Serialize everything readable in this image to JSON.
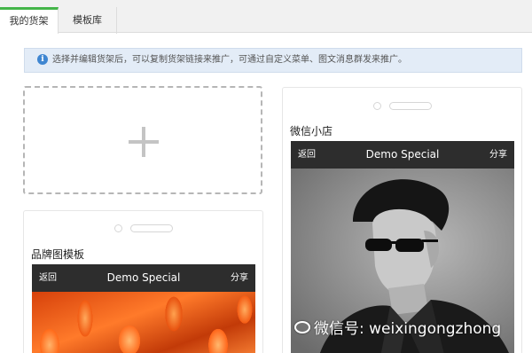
{
  "tabs": [
    {
      "label": "我的货架",
      "active": true
    },
    {
      "label": "模板库",
      "active": false
    }
  ],
  "notice": {
    "icon": "info-icon",
    "text": "选择并编辑货架后，可以复制货架链接来推广，可通过自定义菜单、图文消息群发来推广。"
  },
  "add_shelf": {
    "icon": "plus-icon"
  },
  "templates": [
    {
      "title": "品牌图模板",
      "phone": {
        "back": "返回",
        "title": "Demo Special",
        "share": "分享"
      },
      "image": "orange-flower-petals"
    },
    {
      "title": "微信小店",
      "phone": {
        "back": "返回",
        "title": "Demo Special",
        "share": "分享"
      },
      "image": "man-in-sunglasses-bw"
    }
  ],
  "watermark": {
    "text": "微信号: weixingongzhong",
    "icon": "wechat-icon"
  },
  "colors": {
    "accent": "#44b549",
    "notice_bg": "#e3ecf7",
    "phone_bar": "#2d2d2d",
    "info": "#3f86d1"
  }
}
